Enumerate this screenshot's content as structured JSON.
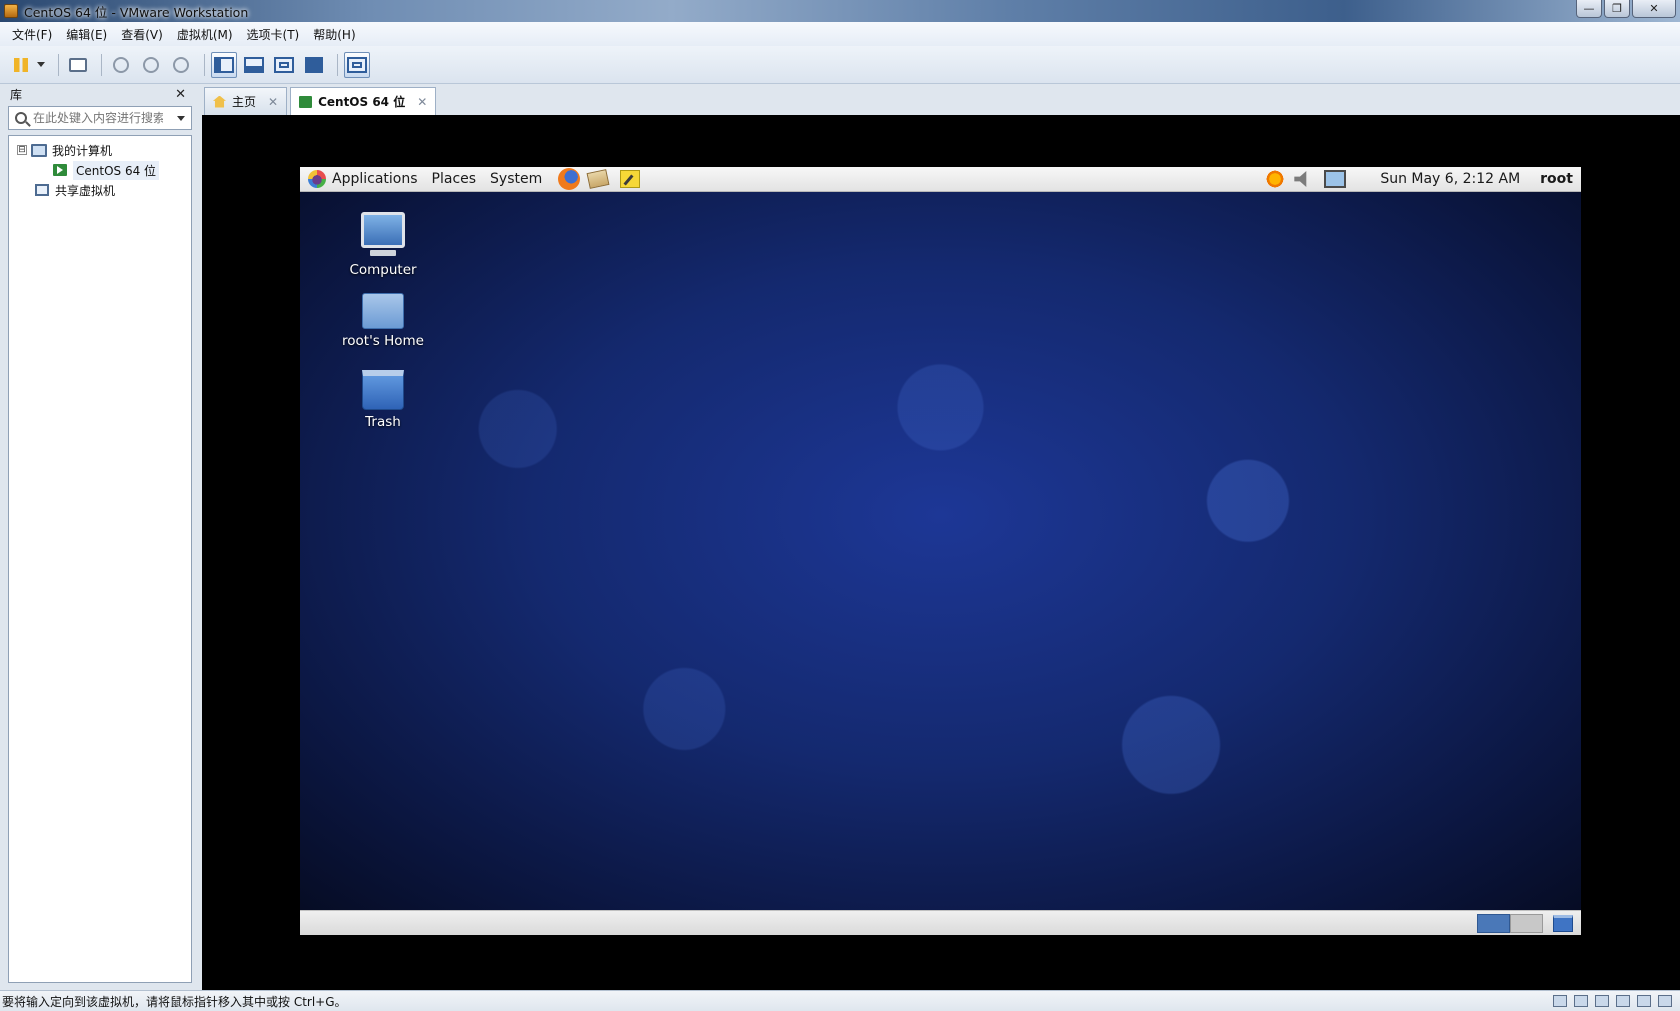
{
  "window": {
    "title": "CentOS 64 位 - VMware Workstation",
    "controls": [
      "—",
      "❐",
      "✕"
    ]
  },
  "menu": [
    "文件(F)",
    "编辑(E)",
    "查看(V)",
    "虚拟机(M)",
    "选项卡(T)",
    "帮助(H)"
  ],
  "library": {
    "title": "库",
    "close": "✕",
    "search_placeholder": "在此处键入内容进行搜索",
    "tree": {
      "expander": "⊟",
      "my_computer": "我的计算机",
      "vm": "CentOS 64 位",
      "shared": "共享虚拟机"
    }
  },
  "tabs": [
    {
      "label": "主页",
      "close": "✕"
    },
    {
      "label": "CentOS 64 位",
      "close": "✕"
    }
  ],
  "guest": {
    "top_panel": {
      "applications": "Applications",
      "places": "Places",
      "system": "System",
      "clock": "Sun May  6,  2:12 AM",
      "user": "root"
    },
    "desktop_icons": [
      "Computer",
      "root's Home",
      "Trash"
    ]
  },
  "status": {
    "message": "要将输入定向到该虚拟机，请将鼠标指针移入其中或按 Ctrl+G。"
  }
}
